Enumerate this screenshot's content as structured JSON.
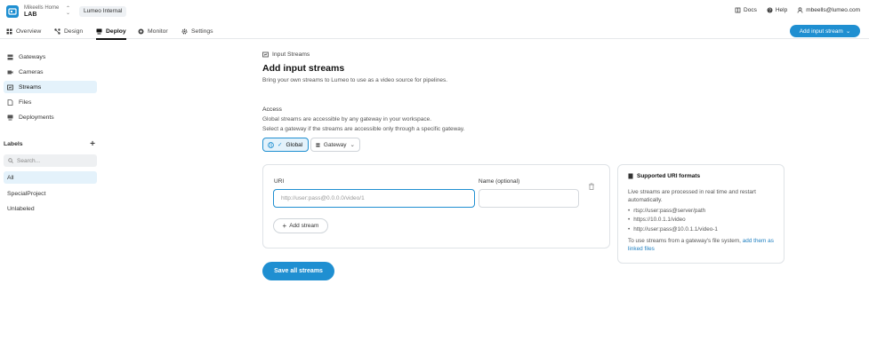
{
  "topbar": {
    "org": "Mikeells Home",
    "workspace": "LAB",
    "environment": "Lumeo Internal",
    "docs": "Docs",
    "help": "Help",
    "user_email": "mbeells@lumeo.com"
  },
  "nav": {
    "tabs": [
      {
        "label": "Overview",
        "icon": "grid-icon"
      },
      {
        "label": "Design",
        "icon": "nodes-icon"
      },
      {
        "label": "Deploy",
        "icon": "deploy-icon",
        "active": true
      },
      {
        "label": "Monitor",
        "icon": "monitor-icon"
      },
      {
        "label": "Settings",
        "icon": "gear-icon"
      }
    ],
    "primary_action": "Add input stream"
  },
  "sidebar": {
    "items": [
      {
        "label": "Gateways",
        "icon": "server-icon"
      },
      {
        "label": "Cameras",
        "icon": "camera-icon"
      },
      {
        "label": "Streams",
        "icon": "stream-icon",
        "active": true
      },
      {
        "label": "Files",
        "icon": "file-icon"
      },
      {
        "label": "Deployments",
        "icon": "deployments-icon"
      }
    ],
    "labels_title": "Labels",
    "search_placeholder": "Search...",
    "labels": [
      {
        "label": "All",
        "active": true
      },
      {
        "label": "SpecialProject"
      },
      {
        "label": "Unlabeled"
      }
    ]
  },
  "main": {
    "breadcrumb": "Input Streams",
    "title": "Add input streams",
    "subtitle": "Bring your own streams to Lumeo to use as a video source for pipelines.",
    "access": {
      "title": "Access",
      "desc1": "Global streams are accessible by any gateway in your workspace.",
      "desc2": "Select a gateway if the streams are accessible only through a specific gateway.",
      "global_label": "Global",
      "gateway_label": "Gateway"
    },
    "form": {
      "uri_label": "URI",
      "name_label": "Name (optional)",
      "uri_placeholder": "http://user:pass@0.0.0.0/video/1",
      "add_stream": "Add stream",
      "save_all": "Save all streams"
    },
    "info": {
      "title": "Supported URI formats",
      "paragraph": "Live streams are processed in real time and restart automatically.",
      "formats": [
        "rtsp://user:pass@server/path",
        "https://10.0.1.1/video",
        "http://user:pass@10.0.1.1/video-1"
      ],
      "footer_text": "To use streams from a gateway's file system,",
      "footer_link": "add them as linked files"
    }
  },
  "colors": {
    "accent": "#1f8fd1",
    "accent_light": "#e4f2fb",
    "border": "#dfe3e7"
  }
}
